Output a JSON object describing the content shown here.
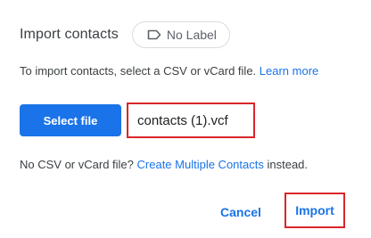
{
  "dialog": {
    "title": "Import contacts",
    "label_chip": {
      "icon": "label-icon",
      "text": "No Label"
    },
    "instructions": {
      "text": "To import contacts, select a CSV or vCard file.",
      "link": "Learn more"
    },
    "select_file_label": "Select file",
    "selected_file": "contacts (1).vcf",
    "no_file": {
      "prefix": "No CSV or vCard file?",
      "link": "Create Multiple Contacts",
      "suffix": "instead."
    },
    "actions": {
      "cancel_label": "Cancel",
      "import_label": "Import"
    }
  },
  "colors": {
    "accent": "#1a73e8",
    "highlight_border": "#d9262b",
    "text": "#3c4043"
  }
}
